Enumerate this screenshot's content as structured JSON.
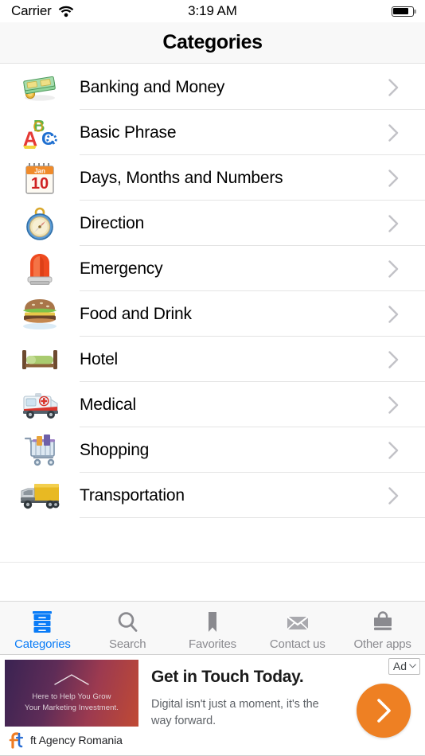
{
  "status_bar": {
    "carrier": "Carrier",
    "wifi_icon": "wifi-icon",
    "time": "3:19 AM",
    "battery_icon": "battery-icon",
    "battery_level_percent": 80
  },
  "nav_bar": {
    "title": "Categories"
  },
  "list": {
    "rows": [
      {
        "label": "Banking and Money",
        "icon": "money-stack-icon",
        "chevron": "chevron-right-icon"
      },
      {
        "label": "Basic Phrase",
        "icon": "abc-letters-icon",
        "chevron": "chevron-right-icon"
      },
      {
        "label": "Days, Months and Numbers",
        "icon": "calendar-icon",
        "chevron": "chevron-right-icon",
        "calendar_month": "Jan",
        "calendar_day": "10"
      },
      {
        "label": "Direction",
        "icon": "compass-icon",
        "chevron": "chevron-right-icon"
      },
      {
        "label": "Emergency",
        "icon": "siren-icon",
        "chevron": "chevron-right-icon"
      },
      {
        "label": "Food and Drink",
        "icon": "hamburger-icon",
        "chevron": "chevron-right-icon"
      },
      {
        "label": "Hotel",
        "icon": "bed-icon",
        "chevron": "chevron-right-icon"
      },
      {
        "label": "Medical",
        "icon": "ambulance-icon",
        "chevron": "chevron-right-icon"
      },
      {
        "label": "Shopping",
        "icon": "shopping-cart-icon",
        "chevron": "chevron-right-icon"
      },
      {
        "label": "Transportation",
        "icon": "truck-icon",
        "chevron": "chevron-right-icon"
      }
    ]
  },
  "tab_bar": {
    "active_index": 0,
    "active_color": "#0a7cf7",
    "inactive_color": "#8a8a8f",
    "items": [
      {
        "label": "Categories",
        "icon": "file-cabinet-icon"
      },
      {
        "label": "Search",
        "icon": "search-icon"
      },
      {
        "label": "Favorites",
        "icon": "bookmark-icon"
      },
      {
        "label": "Contact us",
        "icon": "envelope-icon"
      },
      {
        "label": "Other apps",
        "icon": "briefcase-icon"
      }
    ]
  },
  "ad": {
    "badge_label": "Ad",
    "badge_caret_icon": "chevron-down-icon",
    "image_caption_line1": "Here to Help You Grow",
    "image_caption_line2": "Your Marketing Investment.",
    "image_chevron_icon": "chevron-up-icon",
    "advertiser_logo": "ft-logo-icon",
    "advertiser_name": "ft Agency Romania",
    "headline": "Get in Touch Today.",
    "body": "Digital isn't just a moment, it's the way forward.",
    "cta_icon": "chevron-right-icon",
    "cta_color": "#ee8023"
  }
}
